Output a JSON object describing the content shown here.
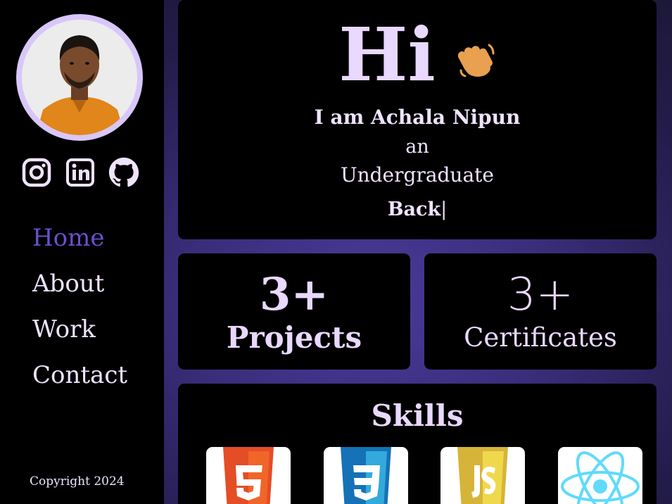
{
  "sidebar": {
    "social": [
      {
        "name": "instagram-icon"
      },
      {
        "name": "linkedin-icon"
      },
      {
        "name": "github-icon"
      }
    ],
    "nav": [
      {
        "label": "Home",
        "active": true
      },
      {
        "label": "About",
        "active": false
      },
      {
        "label": "Work",
        "active": false
      },
      {
        "label": "Contact",
        "active": false
      }
    ],
    "copyright": "Copyright 2024"
  },
  "hero": {
    "greeting": "Hi",
    "intro_prefix": "I am ",
    "name": "Achala Nipun",
    "line2": "an",
    "line3": "Undergraduate",
    "typed": "Back",
    "cursor": "|"
  },
  "stats": {
    "projects": {
      "value": "3+",
      "label": "Projects"
    },
    "certificates": {
      "value": "3+",
      "label": "Certificates"
    }
  },
  "skills": {
    "title": "Skills",
    "items": [
      {
        "name": "html5-icon"
      },
      {
        "name": "css3-icon"
      },
      {
        "name": "javascript-icon"
      },
      {
        "name": "react-icon"
      }
    ]
  },
  "colors": {
    "accent": "#d9c6fb",
    "text": "#efe3ff",
    "active_nav": "#6b4fd0",
    "background_glow": "#4a3a9a"
  }
}
